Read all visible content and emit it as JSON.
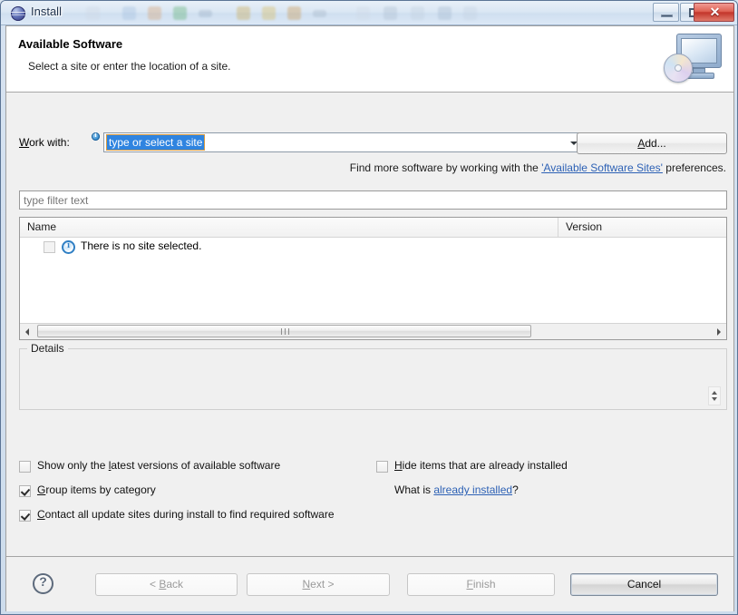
{
  "window": {
    "title": "Install",
    "icon": "eclipse-globe-icon",
    "controls": {
      "minimize": "minimize-icon",
      "maximize": "maximize-icon",
      "close": "✕"
    }
  },
  "banner": {
    "title": "Available Software",
    "subtitle": "Select a site or enter the location of a site.",
    "image": "computer-cd-banner-icon"
  },
  "work_with": {
    "label_prefix": "W",
    "label_rest": "ork with:",
    "info_icon": "info-icon",
    "value": "type or select a site",
    "dropdown_icon": "chevron-down-icon",
    "add_button": {
      "prefix": "A",
      "rest": "dd..."
    }
  },
  "find_more": {
    "before": "Find more software by working with the ",
    "link": "'Available Software Sites'",
    "after": " preferences."
  },
  "filter": {
    "placeholder": "type filter text",
    "value": ""
  },
  "table": {
    "columns": [
      "Name",
      "Version"
    ],
    "rows": [
      {
        "checked": false,
        "enabled": false,
        "icon": "info-icon",
        "name": "There is no site selected.",
        "version": ""
      }
    ],
    "scrollbar": {
      "left_arrow": "arrow-left-icon",
      "right_arrow": "arrow-right-icon",
      "grip": "scrollbar-grip"
    }
  },
  "details": {
    "legend": "Details",
    "text": "",
    "spinner": "resize-spinner-icon"
  },
  "options": [
    {
      "id": "show-latest-versions",
      "checked": false,
      "pre": "Show only the ",
      "mnemonic": "l",
      "post": "atest versions of available software"
    },
    {
      "id": "group-by-category",
      "checked": true,
      "pre": "",
      "mnemonic": "G",
      "post": "roup items by category"
    },
    {
      "id": "contact-update-sites",
      "checked": true,
      "pre": "",
      "mnemonic": "C",
      "post": "ontact all update sites during install to find required software"
    },
    {
      "id": "hide-installed",
      "checked": false,
      "pre": "",
      "mnemonic": "H",
      "post": "ide items that are already installed"
    }
  ],
  "what_is": {
    "before": "What is ",
    "link": "already installed",
    "after": "?"
  },
  "buttons": {
    "help": "?",
    "back": {
      "pre": "< ",
      "mnemonic": "B",
      "post": "ack",
      "enabled": false
    },
    "next": {
      "pre": "",
      "mnemonic": "N",
      "post": "ext >",
      "enabled": false
    },
    "finish": {
      "pre": "",
      "mnemonic": "F",
      "post": "inish",
      "enabled": false
    },
    "cancel": {
      "pre": "",
      "mnemonic": "",
      "post": "Cancel",
      "enabled": true
    }
  },
  "colors": {
    "link": "#2d61b5",
    "selection": "#2f84e0",
    "dialog_bg": "#f0f0f0",
    "close_button": "#c3352b"
  }
}
